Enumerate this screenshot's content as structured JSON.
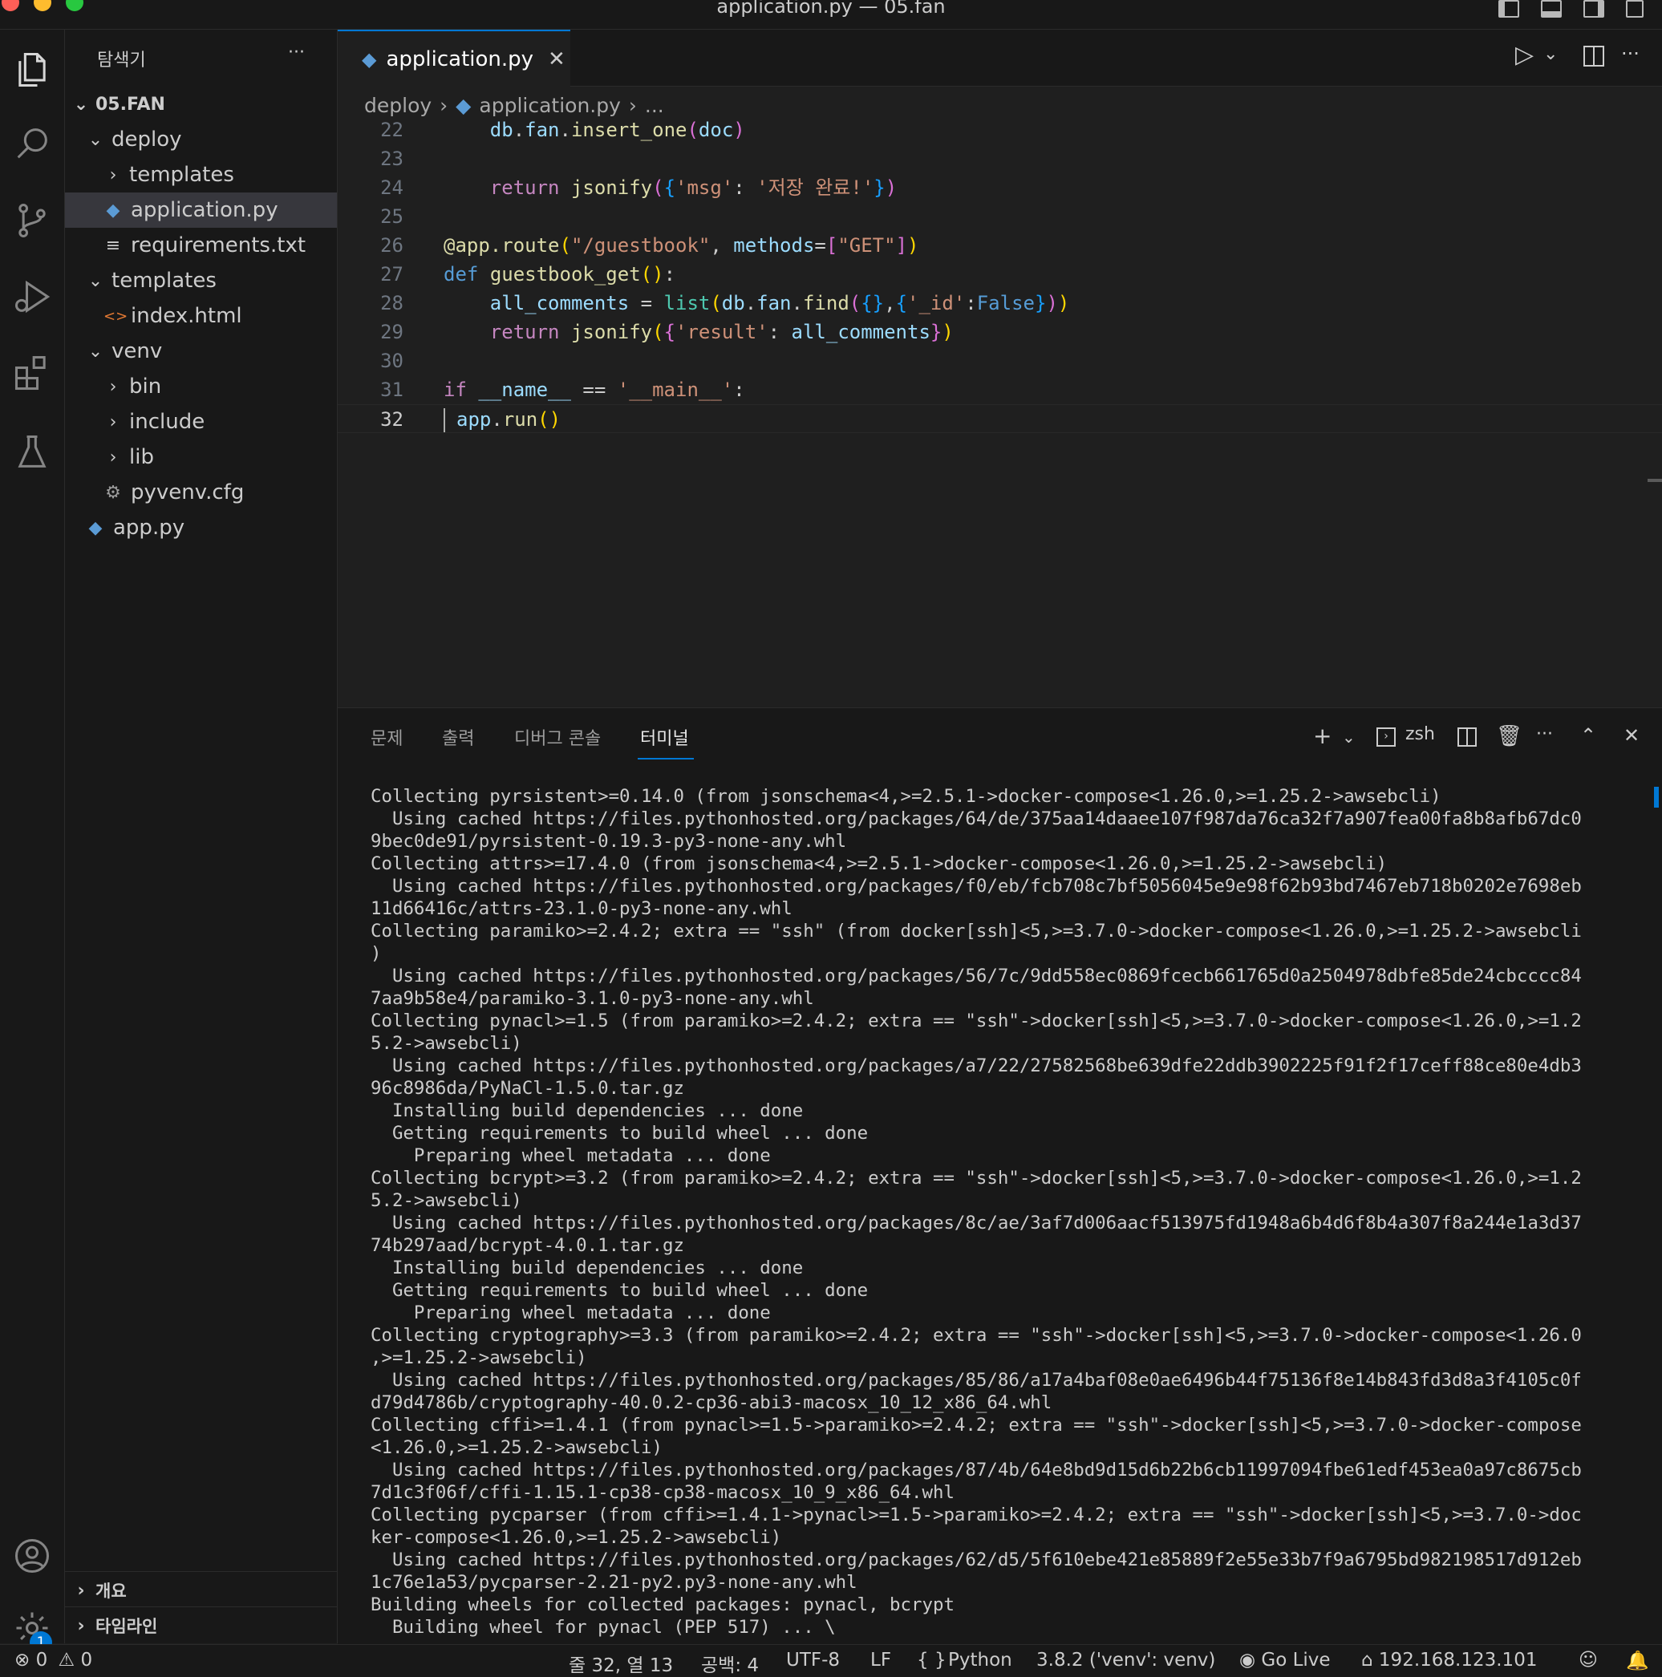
{
  "window": {
    "title": "application.py — 05.fan"
  },
  "sidebar": {
    "title": "탐색기",
    "more": "···",
    "root": "05.FAN",
    "tree": [
      {
        "label": "deploy",
        "chevron": "⌄",
        "icon": ""
      },
      {
        "label": "templates",
        "chevron": "›",
        "icon": ""
      },
      {
        "label": "application.py",
        "chevron": "",
        "icon": "python-file-icon"
      },
      {
        "label": "requirements.txt",
        "chevron": "",
        "icon": "text-file-icon"
      },
      {
        "label": "templates",
        "chevron": "⌄",
        "icon": ""
      },
      {
        "label": "index.html",
        "chevron": "",
        "icon": "html-file-icon"
      },
      {
        "label": "venv",
        "chevron": "⌄",
        "icon": ""
      },
      {
        "label": "bin",
        "chevron": "›",
        "icon": ""
      },
      {
        "label": "include",
        "chevron": "›",
        "icon": ""
      },
      {
        "label": "lib",
        "chevron": "›",
        "icon": ""
      },
      {
        "label": "pyvenv.cfg",
        "chevron": "",
        "icon": "gear-file-icon"
      },
      {
        "label": "app.py",
        "chevron": "",
        "icon": "python-file-icon"
      }
    ],
    "outline": "개요",
    "timeline": "타임라인"
  },
  "editor": {
    "tab_label": "application.py",
    "breadcrumb": [
      "deploy",
      "application.py",
      "..."
    ],
    "line_numbers": [
      "22",
      "23",
      "24",
      "25",
      "26",
      "27",
      "28",
      "29",
      "30",
      "31",
      "32"
    ]
  },
  "panel": {
    "tabs": [
      "문제",
      "출력",
      "디버그 콘솔",
      "터미널"
    ],
    "shell": "zsh",
    "terminal_lines": [
      "Collecting pyrsistent>=0.14.0 (from jsonschema<4,>=2.5.1->docker-compose<1.26.0,>=1.25.2->awsebcli)",
      "  Using cached https://files.pythonhosted.org/packages/64/de/375aa14daaee107f987da76ca32f7a907fea00fa8b8afb67dc0",
      "9bec0de91/pyrsistent-0.19.3-py3-none-any.whl",
      "Collecting attrs>=17.4.0 (from jsonschema<4,>=2.5.1->docker-compose<1.26.0,>=1.25.2->awsebcli)",
      "  Using cached https://files.pythonhosted.org/packages/f0/eb/fcb708c7bf5056045e9e98f62b93bd7467eb718b0202e7698eb",
      "11d66416c/attrs-23.1.0-py3-none-any.whl",
      "Collecting paramiko>=2.4.2; extra == \"ssh\" (from docker[ssh]<5,>=3.7.0->docker-compose<1.26.0,>=1.25.2->awsebcli",
      ")",
      "  Using cached https://files.pythonhosted.org/packages/56/7c/9dd558ec0869fcecb661765d0a2504978dbfe85de24cbcccc84",
      "7aa9b58e4/paramiko-3.1.0-py3-none-any.whl",
      "Collecting pynacl>=1.5 (from paramiko>=2.4.2; extra == \"ssh\"->docker[ssh]<5,>=3.7.0->docker-compose<1.26.0,>=1.2",
      "5.2->awsebcli)",
      "  Using cached https://files.pythonhosted.org/packages/a7/22/27582568be639dfe22ddb3902225f91f2f17ceff88ce80e4db3",
      "96c8986da/PyNaCl-1.5.0.tar.gz",
      "  Installing build dependencies ... done",
      "  Getting requirements to build wheel ... done",
      "    Preparing wheel metadata ... done",
      "Collecting bcrypt>=3.2 (from paramiko>=2.4.2; extra == \"ssh\"->docker[ssh]<5,>=3.7.0->docker-compose<1.26.0,>=1.2",
      "5.2->awsebcli)",
      "  Using cached https://files.pythonhosted.org/packages/8c/ae/3af7d006aacf513975fd1948a6b4d6f8b4a307f8a244e1a3d37",
      "74b297aad/bcrypt-4.0.1.tar.gz",
      "  Installing build dependencies ... done",
      "  Getting requirements to build wheel ... done",
      "    Preparing wheel metadata ... done",
      "Collecting cryptography>=3.3 (from paramiko>=2.4.2; extra == \"ssh\"->docker[ssh]<5,>=3.7.0->docker-compose<1.26.0",
      ",>=1.25.2->awsebcli)",
      "  Using cached https://files.pythonhosted.org/packages/85/86/a17a4baf08e0ae6496b44f75136f8e14b843fd3d8a3f4105c0f",
      "d79d4786b/cryptography-40.0.2-cp36-abi3-macosx_10_12_x86_64.whl",
      "Collecting cffi>=1.4.1 (from pynacl>=1.5->paramiko>=2.4.2; extra == \"ssh\"->docker[ssh]<5,>=3.7.0->docker-compose",
      "<1.26.0,>=1.25.2->awsebcli)",
      "  Using cached https://files.pythonhosted.org/packages/87/4b/64e8bd9d15d6b22b6cb11997094fbe61edf453ea0a97c8675cb",
      "7d1c3f06f/cffi-1.15.1-cp38-cp38-macosx_10_9_x86_64.whl",
      "Collecting pycparser (from cffi>=1.4.1->pynacl>=1.5->paramiko>=2.4.2; extra == \"ssh\"->docker[ssh]<5,>=3.7.0->doc",
      "ker-compose<1.26.0,>=1.25.2->awsebcli)",
      "  Using cached https://files.pythonhosted.org/packages/62/d5/5f610ebe421e85889f2e55e33b7f9a6795bd982198517d912eb",
      "1c76e1a53/pycparser-2.21-py2.py3-none-any.whl",
      "Building wheels for collected packages: pynacl, bcrypt",
      "  Building wheel for pynacl (PEP 517) ... \\"
    ]
  },
  "statusbar": {
    "errors": "0",
    "warnings": "0",
    "position": "줄 32, 열 13",
    "spaces": "공백: 4",
    "encoding": "UTF-8",
    "eol": "LF",
    "language_braces": "{ }",
    "language": "Python",
    "interpreter": "3.8.2 ('venv': venv)",
    "golive": "Go Live",
    "ip": "192.168.123.101",
    "notifications_badge": "1"
  },
  "colors": {
    "accent": "#0078d4",
    "editor_bg": "#1f1f1f",
    "chrome_bg": "#181818",
    "selection": "#37373d"
  }
}
